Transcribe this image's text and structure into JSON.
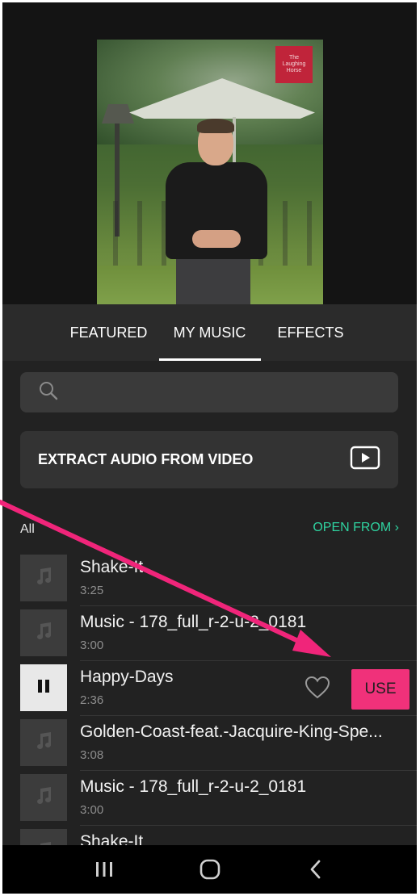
{
  "preview": {
    "logo_text": "The Laughing Horse"
  },
  "tabs": [
    {
      "label": "FEATURED"
    },
    {
      "label": "MY MUSIC",
      "active": true
    },
    {
      "label": "EFFECTS"
    }
  ],
  "search": {
    "placeholder": "",
    "icon": "search-icon"
  },
  "extract": {
    "label": "EXTRACT AUDIO FROM VIDEO",
    "icon": "video-play-icon"
  },
  "list_header": {
    "all_label": "All",
    "open_from": "OPEN FROM ›"
  },
  "tracks": [
    {
      "title": "Shake-It",
      "duration": "3:25",
      "icon": "music-note-icon"
    },
    {
      "title": "Music - 178_full_r-2-u-2_0181",
      "duration": "3:00",
      "icon": "music-note-icon"
    },
    {
      "title": "Happy-Days",
      "duration": "2:36",
      "icon": "pause-icon",
      "playing": true,
      "use_label": "USE"
    },
    {
      "title": "Golden-Coast-feat.-Jacquire-King-Spe...",
      "duration": "3:08",
      "icon": "music-note-icon"
    },
    {
      "title": "Music - 178_full_r-2-u-2_0181",
      "duration": "3:00",
      "icon": "music-note-icon"
    },
    {
      "title": "Shake-It",
      "duration": "",
      "icon": "music-note-icon"
    }
  ],
  "colors": {
    "accent_green": "#2fd3a0",
    "use_button": "#f0317a",
    "annotation_arrow": "#f0257a"
  },
  "navbar": [
    "recent-apps-icon",
    "home-icon",
    "back-icon"
  ]
}
